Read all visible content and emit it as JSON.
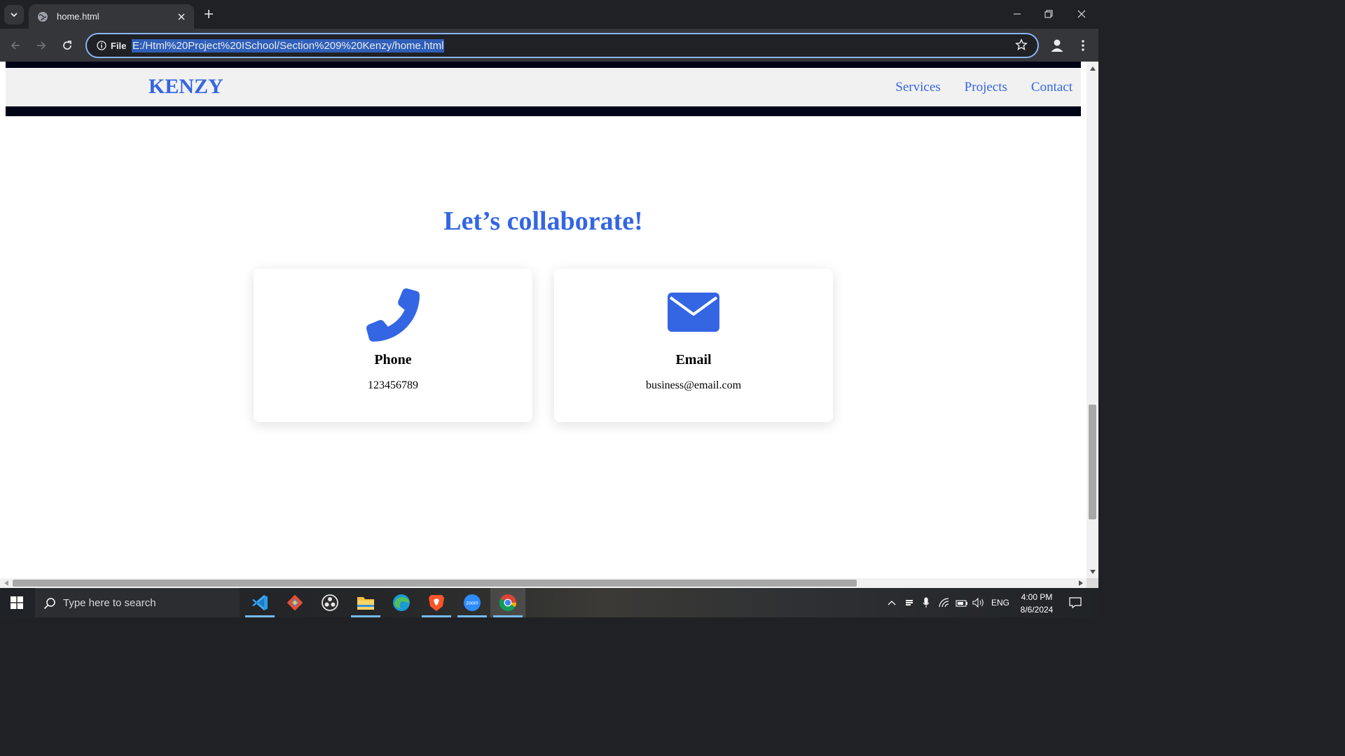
{
  "browser": {
    "tab_title": "home.html",
    "site_chip_label": "File",
    "url": "E:/Html%20Project%20ISchool/Section%209%20Kenzy/home.html"
  },
  "site": {
    "logo": "KENZY",
    "nav": [
      "Services",
      "Projects",
      "Contact"
    ],
    "headline": "Let’s collaborate!",
    "cards": [
      {
        "icon": "phone-icon",
        "title": "Phone",
        "value": "123456789"
      },
      {
        "icon": "envelope-icon",
        "title": "Email",
        "value": "business@email.com"
      }
    ],
    "accent_color": "#3466e3",
    "navbar_border_color": "#000416"
  },
  "taskbar": {
    "search_placeholder": "Type here to search",
    "apps": [
      "vscode-icon",
      "git-icon",
      "obs-icon",
      "file-explorer-icon",
      "edge-icon",
      "brave-icon",
      "zoom-icon",
      "chrome-icon"
    ],
    "zoom_label": "zoom",
    "language": "ENG",
    "time": "4:00 PM",
    "date": "8/6/2024"
  }
}
